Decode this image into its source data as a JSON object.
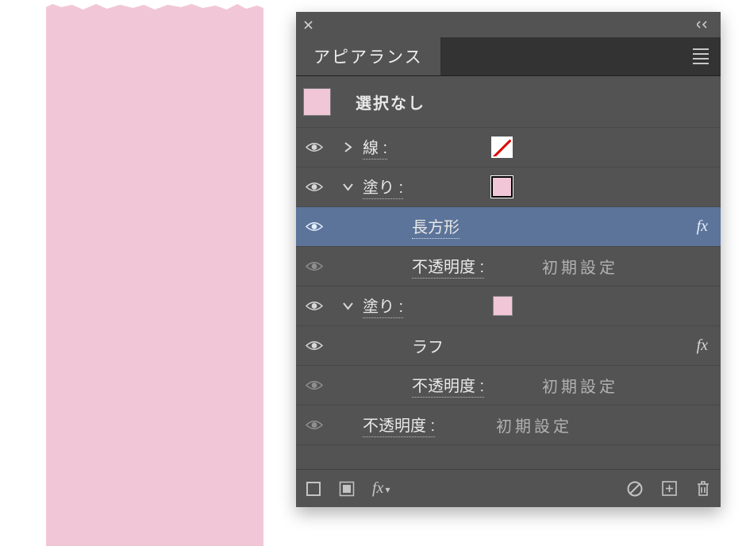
{
  "panel": {
    "tab_label": "アピアランス",
    "selection": {
      "label": "選択なし"
    }
  },
  "rows": {
    "stroke": {
      "label": "線 :",
      "color": "none"
    },
    "fill1": {
      "label": "塗り :",
      "color": "#f1c7d7",
      "expanded": true
    },
    "effect_rect": {
      "label": "長方形"
    },
    "opacity1": {
      "label": "不透明度 :",
      "value": "初期設定"
    },
    "fill2": {
      "label": "塗り :",
      "color": "#f1c7d7",
      "expanded": true
    },
    "effect_rough": {
      "label": "ラフ"
    },
    "opacity2": {
      "label": "不透明度 :",
      "value": "初期設定"
    },
    "opacity_obj": {
      "label": "不透明度 :",
      "value": "初期設定"
    }
  },
  "icons": {
    "fx": "fx"
  }
}
